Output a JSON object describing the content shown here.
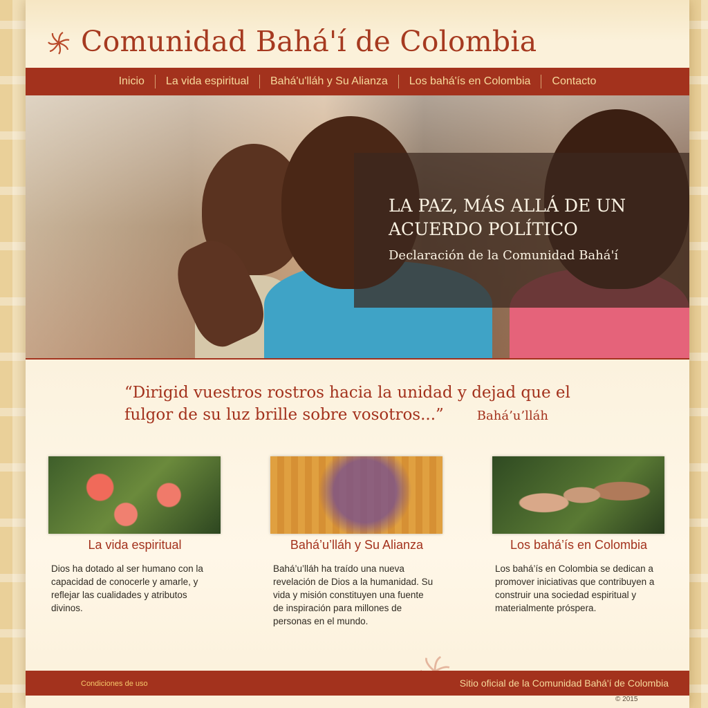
{
  "header": {
    "title": "Comunidad Bahá'í de Colombia"
  },
  "nav": {
    "items": [
      {
        "label": "Inicio"
      },
      {
        "label": "La vida espiritual"
      },
      {
        "label": "Bahá'u'lláh y Su Alianza"
      },
      {
        "label": "Los bahá'ís en Colombia"
      },
      {
        "label": "Contacto"
      }
    ]
  },
  "hero": {
    "title": "LA PAZ, MÁS ALLÁ DE UN ACUERDO POLÍTICO",
    "subtitle": "Declaración de la Comunidad Bahá'í"
  },
  "quote": {
    "text": "“Dirigid vuestros rostros hacia la unidad y dejad que el fulgor de su luz brille sobre vosotros...”",
    "author": "Bahá’u’lláh"
  },
  "columns": [
    {
      "title": "La vida espiritual",
      "text": "Dios ha dotado al ser humano con la capacidad de conocerle y amarle, y reflejar las cualidades y atributos divinos.",
      "image": "red-flowers"
    },
    {
      "title": "Bahá’u’lláh y Su Alianza",
      "text": "Bahá’u’lláh ha traído una nueva revelación de Dios a la humanidad. Su vida y misión constituyen una fuente de inspiración para millones de personas en el mundo.",
      "image": "purple-tree-dome"
    },
    {
      "title": "Los bahá’ís en Colombia",
      "text": "Los bahá’ís en Colombia se dedican a promover iniciativas que contribuyen a construir una sociedad espiritual y materialmente próspera.",
      "image": "group-of-youths"
    }
  ],
  "footer": {
    "terms": "Condiciones de uso",
    "official": "Sitio oficial de la Comunidad Bahá'í de Colombia",
    "copyright": "© 2015"
  },
  "colors": {
    "brand_red": "#a3321d",
    "nav_text": "#f6d99b"
  }
}
